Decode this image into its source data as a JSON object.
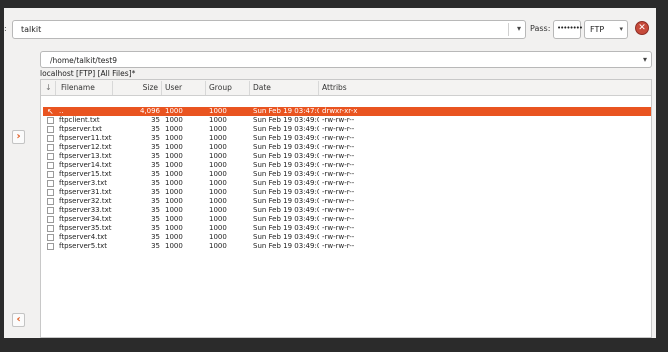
{
  "connection": {
    "user_label": ":",
    "username": "talkit",
    "pass_label": "Pass:",
    "password_mask": "••••••••",
    "protocol": "FTP"
  },
  "path": "/home/talkit/test9",
  "status": "localhost [FTP] [All Files]*",
  "columns": {
    "filename": "Filename",
    "size": "Size",
    "user": "User",
    "group": "Group",
    "date": "Date",
    "attribs": "Attribs"
  },
  "files": [
    {
      "name": "..",
      "size": "4,096",
      "user": "1000",
      "group": "1000",
      "date": "Sun Feb 19 03:47:0",
      "attribs": "drwxr-xr-x"
    },
    {
      "name": "ftpclient.txt",
      "size": "35",
      "user": "1000",
      "group": "1000",
      "date": "Sun Feb 19 03:49:0",
      "attribs": "-rw-rw-r--"
    },
    {
      "name": "ftpserver.txt",
      "size": "35",
      "user": "1000",
      "group": "1000",
      "date": "Sun Feb 19 03:49:0",
      "attribs": "-rw-rw-r--"
    },
    {
      "name": "ftpserver11.txt",
      "size": "35",
      "user": "1000",
      "group": "1000",
      "date": "Sun Feb 19 03:49:0",
      "attribs": "-rw-rw-r--"
    },
    {
      "name": "ftpserver12.txt",
      "size": "35",
      "user": "1000",
      "group": "1000",
      "date": "Sun Feb 19 03:49:0",
      "attribs": "-rw-rw-r--"
    },
    {
      "name": "ftpserver13.txt",
      "size": "35",
      "user": "1000",
      "group": "1000",
      "date": "Sun Feb 19 03:49:0",
      "attribs": "-rw-rw-r--"
    },
    {
      "name": "ftpserver14.txt",
      "size": "35",
      "user": "1000",
      "group": "1000",
      "date": "Sun Feb 19 03:49:0",
      "attribs": "-rw-rw-r--"
    },
    {
      "name": "ftpserver15.txt",
      "size": "35",
      "user": "1000",
      "group": "1000",
      "date": "Sun Feb 19 03:49:0",
      "attribs": "-rw-rw-r--"
    },
    {
      "name": "ftpserver3.txt",
      "size": "35",
      "user": "1000",
      "group": "1000",
      "date": "Sun Feb 19 03:49:0",
      "attribs": "-rw-rw-r--"
    },
    {
      "name": "ftpserver31.txt",
      "size": "35",
      "user": "1000",
      "group": "1000",
      "date": "Sun Feb 19 03:49:0",
      "attribs": "-rw-rw-r--"
    },
    {
      "name": "ftpserver32.txt",
      "size": "35",
      "user": "1000",
      "group": "1000",
      "date": "Sun Feb 19 03:49:0",
      "attribs": "-rw-rw-r--"
    },
    {
      "name": "ftpserver33.txt",
      "size": "35",
      "user": "1000",
      "group": "1000",
      "date": "Sun Feb 19 03:49:0",
      "attribs": "-rw-rw-r--"
    },
    {
      "name": "ftpserver34.txt",
      "size": "35",
      "user": "1000",
      "group": "1000",
      "date": "Sun Feb 19 03:49:0",
      "attribs": "-rw-rw-r--"
    },
    {
      "name": "ftpserver35.txt",
      "size": "35",
      "user": "1000",
      "group": "1000",
      "date": "Sun Feb 19 03:49:0",
      "attribs": "-rw-rw-r--"
    },
    {
      "name": "ftpserver4.txt",
      "size": "35",
      "user": "1000",
      "group": "1000",
      "date": "Sun Feb 19 03:49:0",
      "attribs": "-rw-rw-r--"
    },
    {
      "name": "ftpserver5.txt",
      "size": "35",
      "user": "1000",
      "group": "1000",
      "date": "Sun Feb 19 03:49:0",
      "attribs": "-rw-rw-r--"
    }
  ],
  "icons": {
    "close": "close-icon",
    "right": "chevron-right-icon",
    "left": "chevron-left-icon",
    "dropdown": "chevron-down-icon",
    "updir": "up-directory-icon",
    "file": "file-icon"
  },
  "colors": {
    "selection": "#e95420",
    "accent": "#e0561a",
    "close": "#c64a3a"
  }
}
